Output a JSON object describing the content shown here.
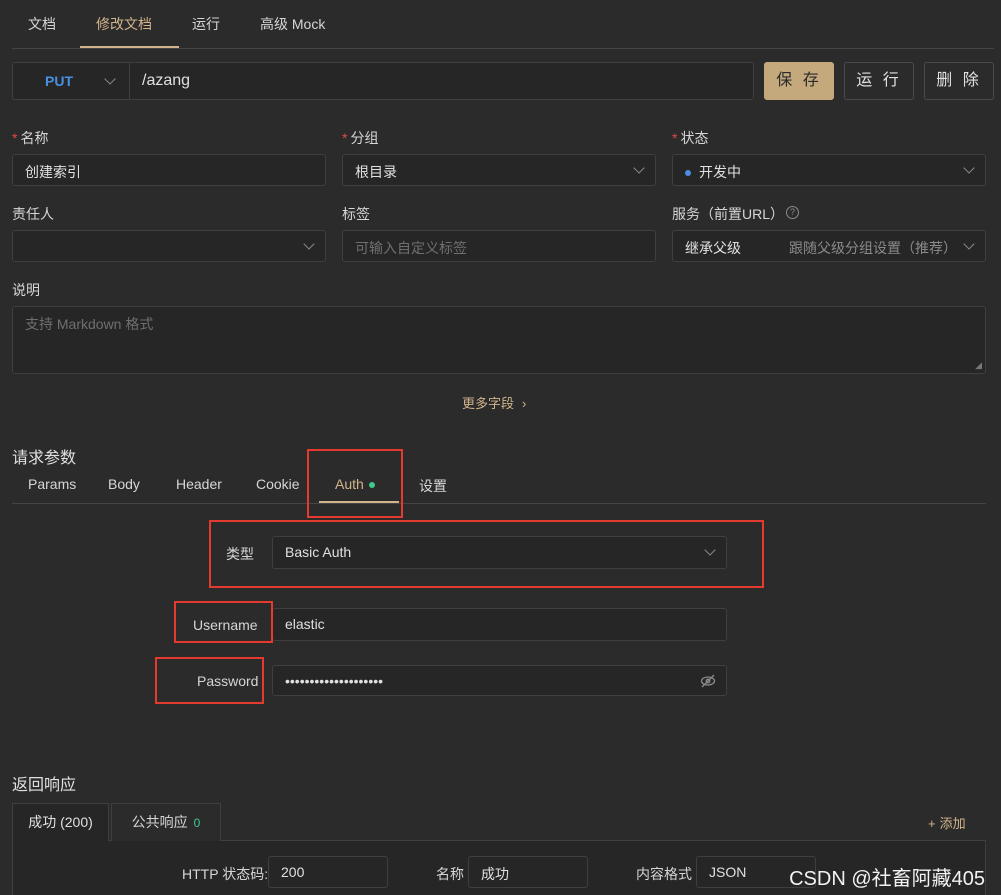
{
  "top_tabs": [
    "文档",
    "修改文档",
    "运行",
    "高级 Mock"
  ],
  "request": {
    "method": "PUT",
    "path": "/azang",
    "buttons": {
      "save": "保 存",
      "run": "运 行",
      "delete": "删 除"
    }
  },
  "form": {
    "name": {
      "label": "名称",
      "required": true,
      "value": "创建索引"
    },
    "group": {
      "label": "分组",
      "required": true,
      "value": "根目录"
    },
    "status": {
      "label": "状态",
      "required": true,
      "value": "开发中",
      "dot_color": "#4a90e2"
    },
    "owner": {
      "label": "责任人",
      "value": ""
    },
    "tags": {
      "label": "标签",
      "placeholder": "可输入自定义标签"
    },
    "service": {
      "label": "服务（前置URL）",
      "value": "继承父级",
      "hint": "跟随父级分组设置（推荐）",
      "help_icon": "question-circle-icon"
    },
    "description": {
      "label": "说明",
      "placeholder": "支持 Markdown 格式"
    },
    "more_fields": "更多字段"
  },
  "params": {
    "title": "请求参数",
    "tabs": [
      "Params",
      "Body",
      "Header",
      "Cookie",
      "Auth",
      "设置"
    ],
    "active_tab": "Auth"
  },
  "auth": {
    "type_label": "类型",
    "type_value": "Basic Auth",
    "username_label": "Username",
    "username_value": "elastic",
    "password_label": "Password",
    "password_mask": "••••••••••••••••••••",
    "eye_icon": "eye-slash-icon"
  },
  "response": {
    "title": "返回响应",
    "tabs": [
      {
        "label": "成功 (200)"
      },
      {
        "label": "公共响应",
        "badge": "0"
      }
    ],
    "add_label": "添加",
    "status_code_label": "HTTP 状态码:",
    "status_code_value": "200",
    "name_label": "名称",
    "name_value": "成功",
    "content_format_label": "内容格式",
    "content_format_value": "JSON"
  },
  "watermark": "CSDN @社畜阿藏405",
  "colors": {
    "accent": "#d2b48c",
    "method": "#4a90e2",
    "highlight_box": "#e53a2f",
    "success_dot": "#3ec98a"
  }
}
